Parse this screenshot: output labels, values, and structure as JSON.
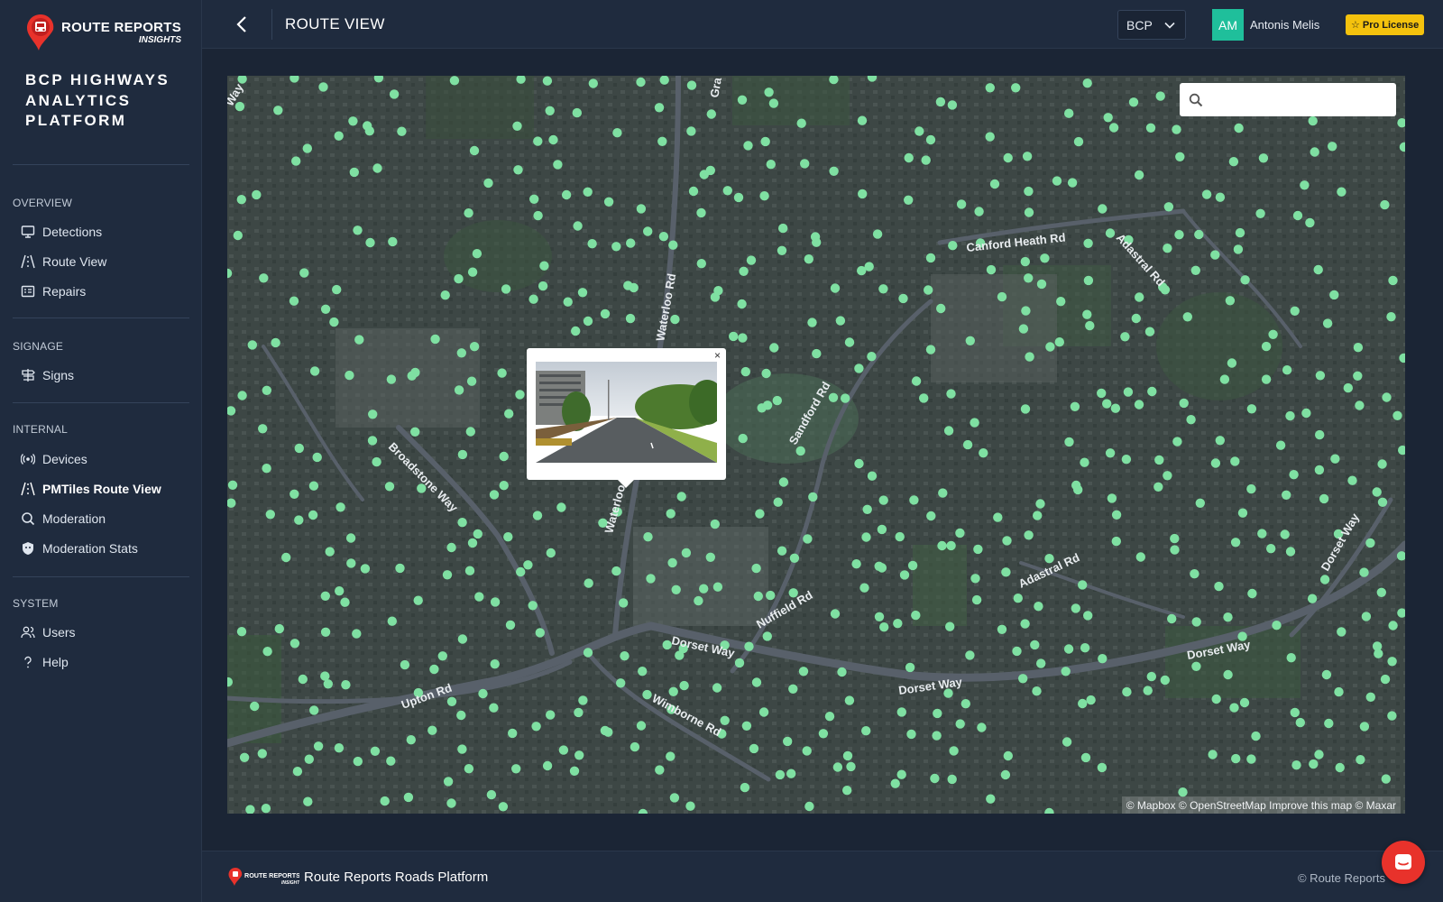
{
  "brand": {
    "line1": "ROUTE REPORTS",
    "line2": "INSIGHTS",
    "platform_title": "BCP HIGHWAYS ANALYTICS PLATFORM",
    "accent": "#1fbf9b"
  },
  "sidebar": {
    "sections": [
      {
        "label": "OVERVIEW",
        "items": [
          {
            "label": "Detections",
            "icon": "monitor-icon"
          },
          {
            "label": "Route View",
            "icon": "road-icon"
          },
          {
            "label": "Repairs",
            "icon": "list-icon"
          }
        ]
      },
      {
        "label": "SIGNAGE",
        "items": [
          {
            "label": "Signs",
            "icon": "signpost-icon"
          }
        ]
      },
      {
        "label": "INTERNAL",
        "items": [
          {
            "label": "Devices",
            "icon": "broadcast-icon"
          },
          {
            "label": "PMTiles Route View",
            "icon": "road-icon",
            "active": true
          },
          {
            "label": "Moderation",
            "icon": "search-icon"
          },
          {
            "label": "Moderation Stats",
            "icon": "shield-icon"
          }
        ]
      },
      {
        "label": "SYSTEM",
        "items": [
          {
            "label": "Users",
            "icon": "users-icon"
          },
          {
            "label": "Help",
            "icon": "question-icon"
          }
        ]
      }
    ]
  },
  "header": {
    "title": "ROUTE VIEW",
    "org_selected": "BCP",
    "user_initials": "AM",
    "user_name": "Antonis Melis",
    "badge": "Pro License",
    "badge_color": "#f4c20d"
  },
  "map": {
    "search_placeholder": "",
    "attribution": "© Mapbox © OpenStreetMap Improve this map © Maxar",
    "dot_color": "#7fe0a2",
    "road_labels": [
      "Way",
      "Gra",
      "Waterloo Rd",
      "Canford Heath Rd",
      "Adastral Rd",
      "Sandford Rd",
      "Broadstone Way",
      "Waterloo Rd",
      "Nuffield Rd",
      "Dorset Way",
      "Dorset Way",
      "Dorset Way",
      "Dorset Way",
      "Upton Rd",
      "Wimborne Rd",
      "Adastral Rd"
    ],
    "popup_close": "×"
  },
  "footer": {
    "name": "Route Reports Roads Platform",
    "copyright": "© Route Reports"
  }
}
